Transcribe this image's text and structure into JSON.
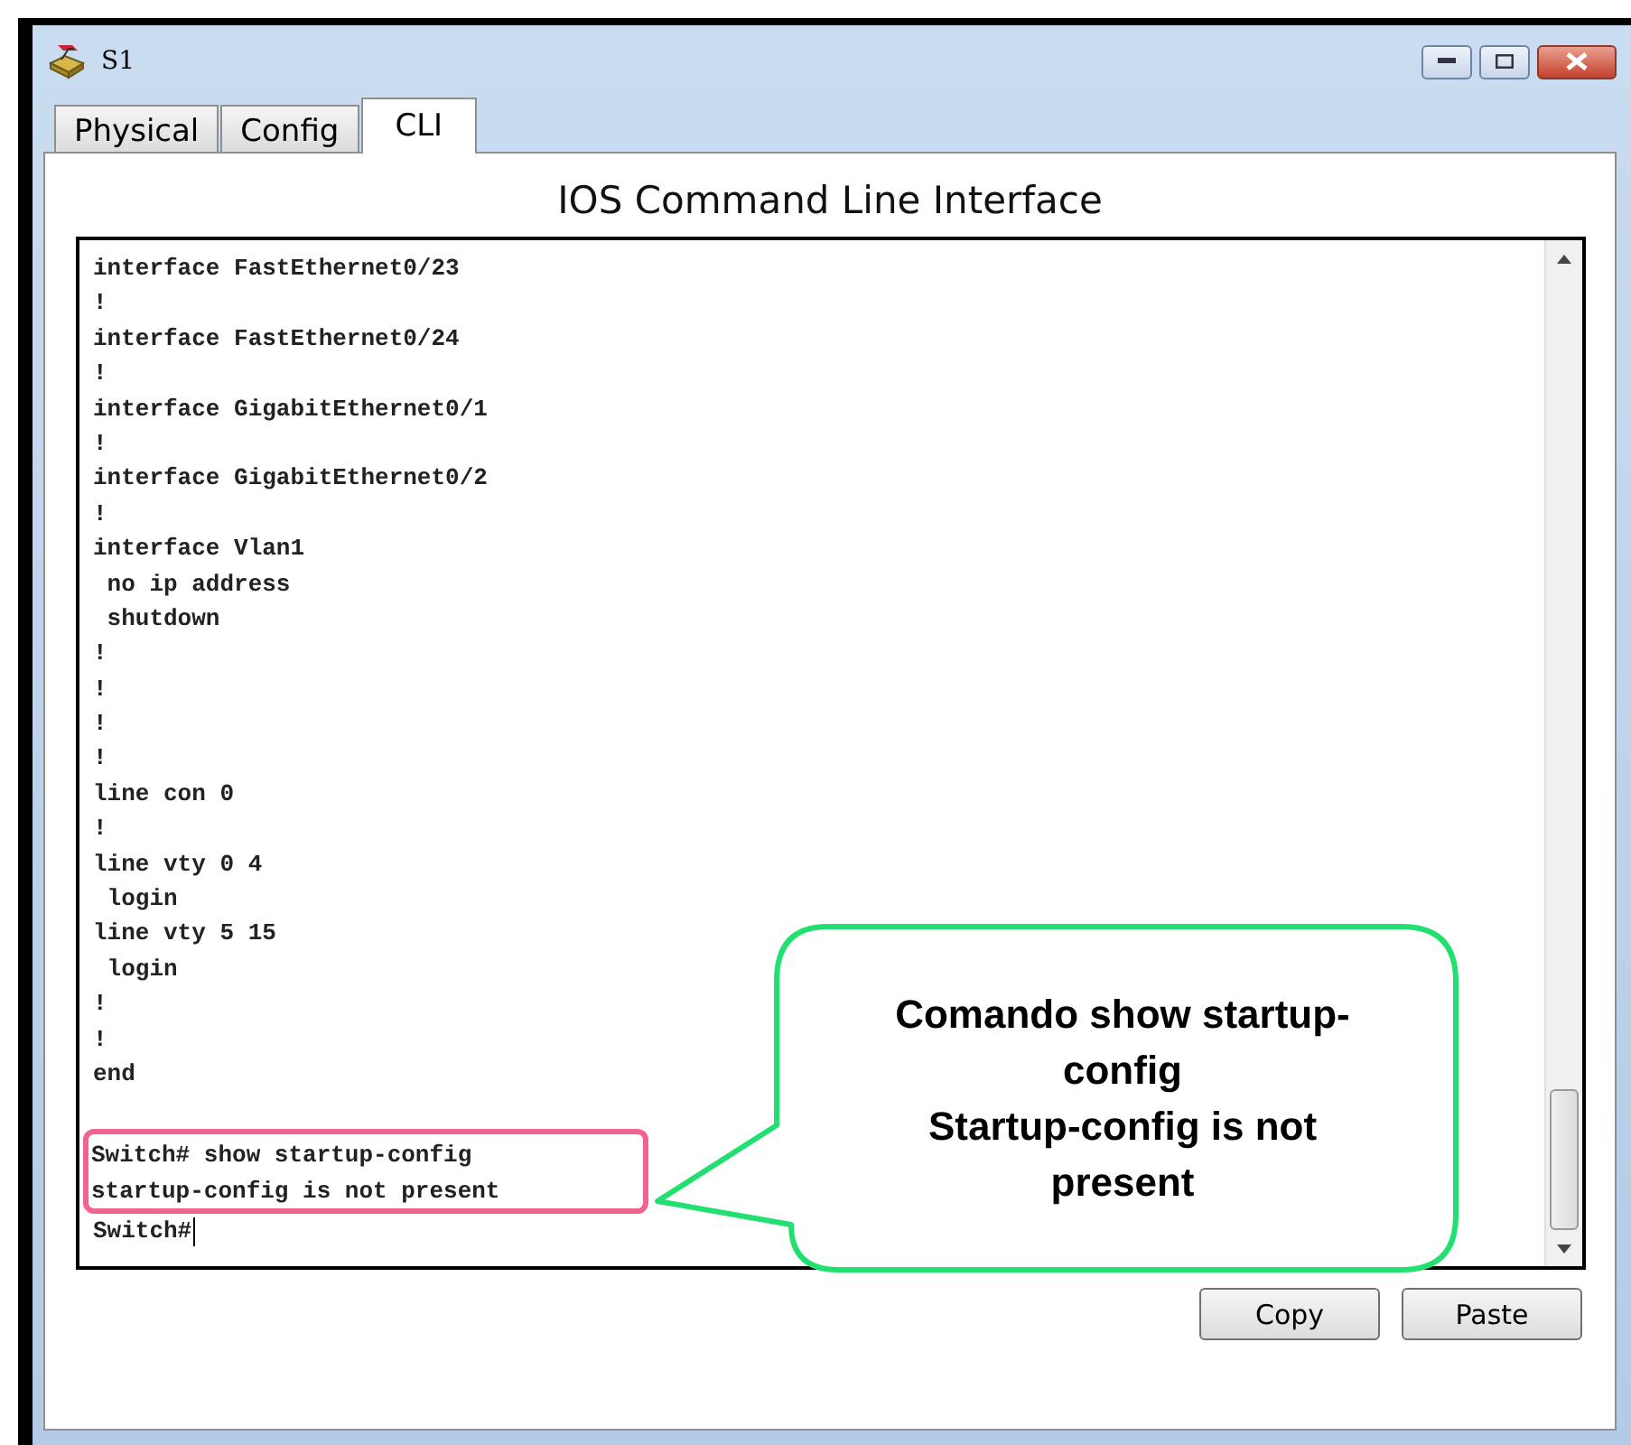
{
  "window": {
    "title": "S1"
  },
  "tabs": [
    {
      "label": "Physical",
      "selected": false
    },
    {
      "label": "Config",
      "selected": false
    },
    {
      "label": "CLI",
      "selected": true
    }
  ],
  "panel_title": "IOS Command Line Interface",
  "terminal": {
    "lines": [
      "interface FastEthernet0/23",
      "!",
      "interface FastEthernet0/24",
      "!",
      "interface GigabitEthernet0/1",
      "!",
      "interface GigabitEthernet0/2",
      "!",
      "interface Vlan1",
      " no ip address",
      " shutdown",
      "!",
      "!",
      "!",
      "!",
      "line con 0",
      "!",
      "line vty 0 4",
      " login",
      "line vty 5 15",
      " login",
      "!",
      "!",
      "end"
    ],
    "highlighted_lines": [
      "Switch# show startup-config",
      "startup-config is not present"
    ],
    "prompt": "Switch#"
  },
  "callout": {
    "lines": [
      "Comando show startup-config",
      "Startup-config is not present"
    ]
  },
  "buttons": [
    "Copy",
    "Paste"
  ]
}
